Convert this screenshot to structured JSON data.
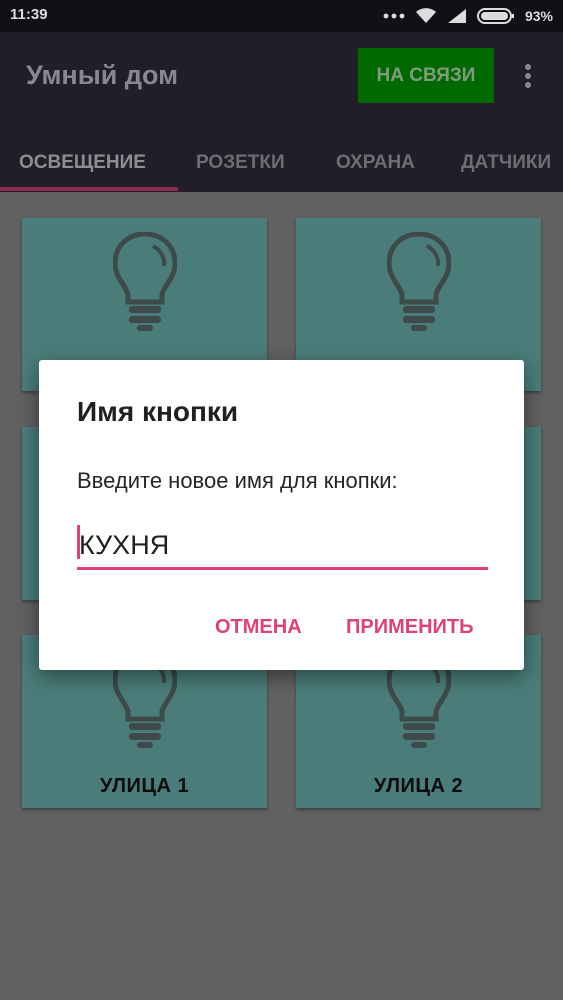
{
  "status_bar": {
    "time": "11:39",
    "battery": "93%",
    "icons": [
      "dots-icon",
      "wifi-icon",
      "signal-icon",
      "battery-icon"
    ]
  },
  "app_bar": {
    "title": "Умный дом",
    "connect_button": "НА СВЯЗИ",
    "tabs": [
      {
        "label": "ОСВЕЩЕНИЕ",
        "active": true
      },
      {
        "label": "РОЗЕТКИ",
        "active": false
      },
      {
        "label": "ОХРАНА",
        "active": false
      },
      {
        "label": "ДАТЧИКИ",
        "active": false
      }
    ]
  },
  "tiles": [
    {
      "label": "",
      "icon": "lightbulb-icon"
    },
    {
      "label": "",
      "icon": "lightbulb-icon"
    },
    {
      "label": "",
      "icon": "lightbulb-icon"
    },
    {
      "label": "",
      "icon": "lightbulb-icon"
    },
    {
      "label": "УЛИЦА 1",
      "icon": "lightbulb-icon"
    },
    {
      "label": "УЛИЦА 2",
      "icon": "lightbulb-icon"
    }
  ],
  "dialog": {
    "title": "Имя кнопки",
    "message": "Введите новое имя для кнопки:",
    "input_value": "КУХНЯ",
    "cancel_label": "ОТМЕНА",
    "apply_label": "ПРИМЕНИТЬ"
  },
  "colors": {
    "accent": "#e0417b",
    "tile": "#4a7d79",
    "connect_button": "#006a00",
    "app_bar": "#221e28"
  }
}
